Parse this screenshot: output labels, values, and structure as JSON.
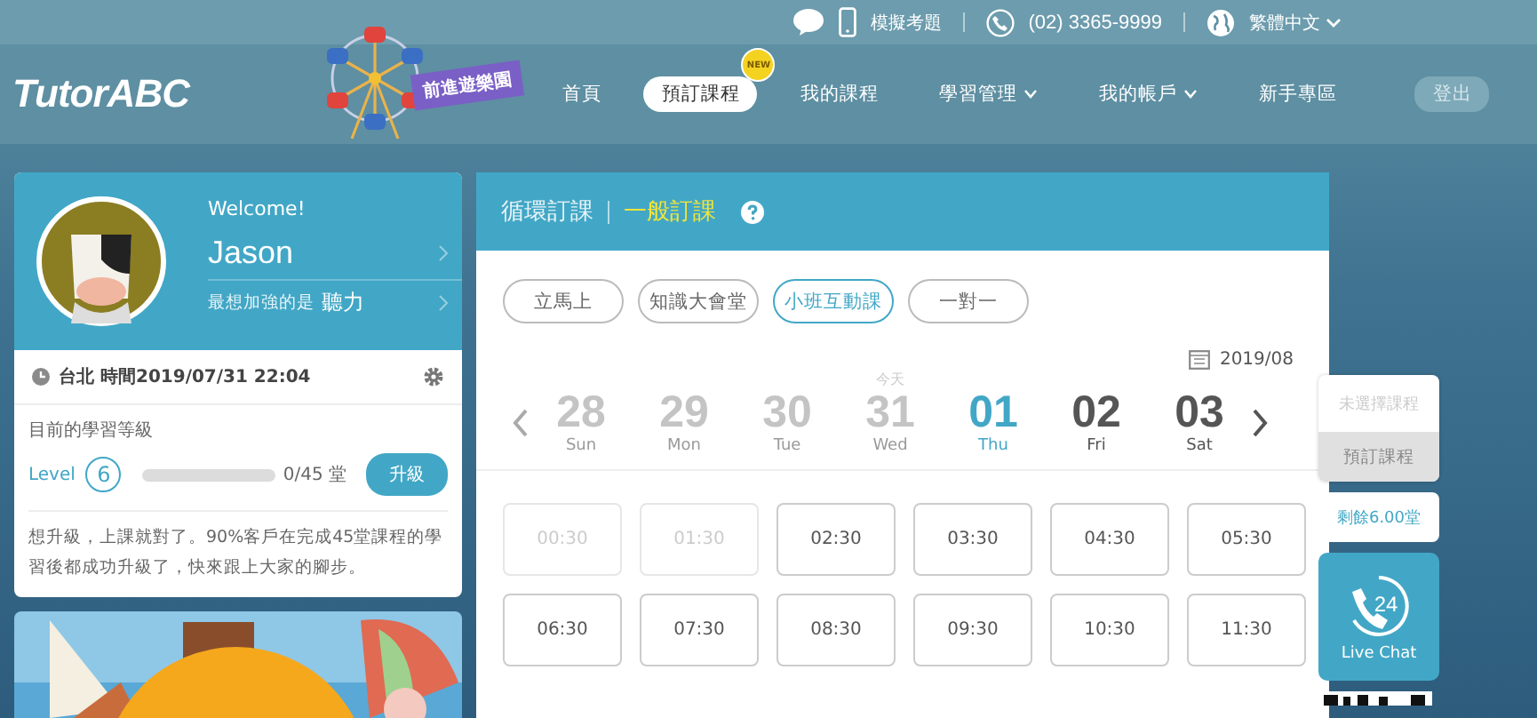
{
  "top_bar": {
    "exam": "模擬考題",
    "phone": "(02) 3365-9999",
    "language": "繁體中文"
  },
  "nav": {
    "logo": "TutorABC",
    "promo": "前進遊樂園",
    "badge": "NEW",
    "logout": "登出",
    "items": [
      {
        "label": "首頁",
        "selected": false,
        "dropdown": false
      },
      {
        "label": "預訂課程",
        "selected": true,
        "dropdown": false
      },
      {
        "label": "我的課程",
        "selected": false,
        "dropdown": false
      },
      {
        "label": "學習管理",
        "selected": false,
        "dropdown": true
      },
      {
        "label": "我的帳戶",
        "selected": false,
        "dropdown": true
      },
      {
        "label": "新手專區",
        "selected": false,
        "dropdown": false
      }
    ]
  },
  "profile": {
    "welcome": "Welcome!",
    "name": "Jason",
    "focus_label": "最想加強的是",
    "focus": "聽力",
    "time": "台北 時間2019/07/31 22:04",
    "level_title": "目前的學習等級",
    "level_label": "Level",
    "level_value": "6",
    "progress": {
      "level": 0
    },
    "progress_text": "0/45 堂",
    "upgrade": "升級",
    "note": "想升級，上課就對了。90%客戶在完成45堂課程的學習後都成功升級了，快來跟上大家的腳步。"
  },
  "booking": {
    "tabs": [
      {
        "label": "循環訂課",
        "selected": false
      },
      {
        "label": "一般訂課",
        "selected": true
      }
    ],
    "types": [
      {
        "label": "立馬上",
        "selected": false
      },
      {
        "label": "知識大會堂",
        "selected": false
      },
      {
        "label": "小班互動課",
        "selected": true
      },
      {
        "label": "一對一",
        "selected": false
      }
    ],
    "month": "2019/08",
    "days": [
      {
        "number": "28",
        "weekday": "Sun",
        "past": true,
        "selected": false
      },
      {
        "number": "29",
        "weekday": "Mon",
        "past": true,
        "selected": false
      },
      {
        "number": "30",
        "weekday": "Tue",
        "past": true,
        "selected": false
      },
      {
        "number": "31",
        "weekday": "Wed",
        "past": true,
        "selected": false,
        "today": "今天"
      },
      {
        "number": "01",
        "weekday": "Thu",
        "past": false,
        "selected": true
      },
      {
        "number": "02",
        "weekday": "Fri",
        "past": false,
        "selected": false
      },
      {
        "number": "03",
        "weekday": "Sat",
        "past": false,
        "selected": false
      }
    ],
    "slots": [
      {
        "time": "00:30",
        "disabled": true
      },
      {
        "time": "01:30",
        "disabled": true
      },
      {
        "time": "02:30",
        "disabled": false
      },
      {
        "time": "03:30",
        "disabled": false
      },
      {
        "time": "04:30",
        "disabled": false
      },
      {
        "time": "05:30",
        "disabled": false
      },
      {
        "time": "06:30",
        "disabled": false
      },
      {
        "time": "07:30",
        "disabled": false
      },
      {
        "time": "08:30",
        "disabled": false
      },
      {
        "time": "09:30",
        "disabled": false
      },
      {
        "time": "10:30",
        "disabled": false
      },
      {
        "time": "11:30",
        "disabled": false
      }
    ]
  },
  "side": {
    "status": "未選擇課程",
    "book": "預訂課程",
    "book_disabled": true,
    "remaining": "剩餘6.00堂",
    "chat": "Live Chat",
    "chat_hours": "24"
  }
}
